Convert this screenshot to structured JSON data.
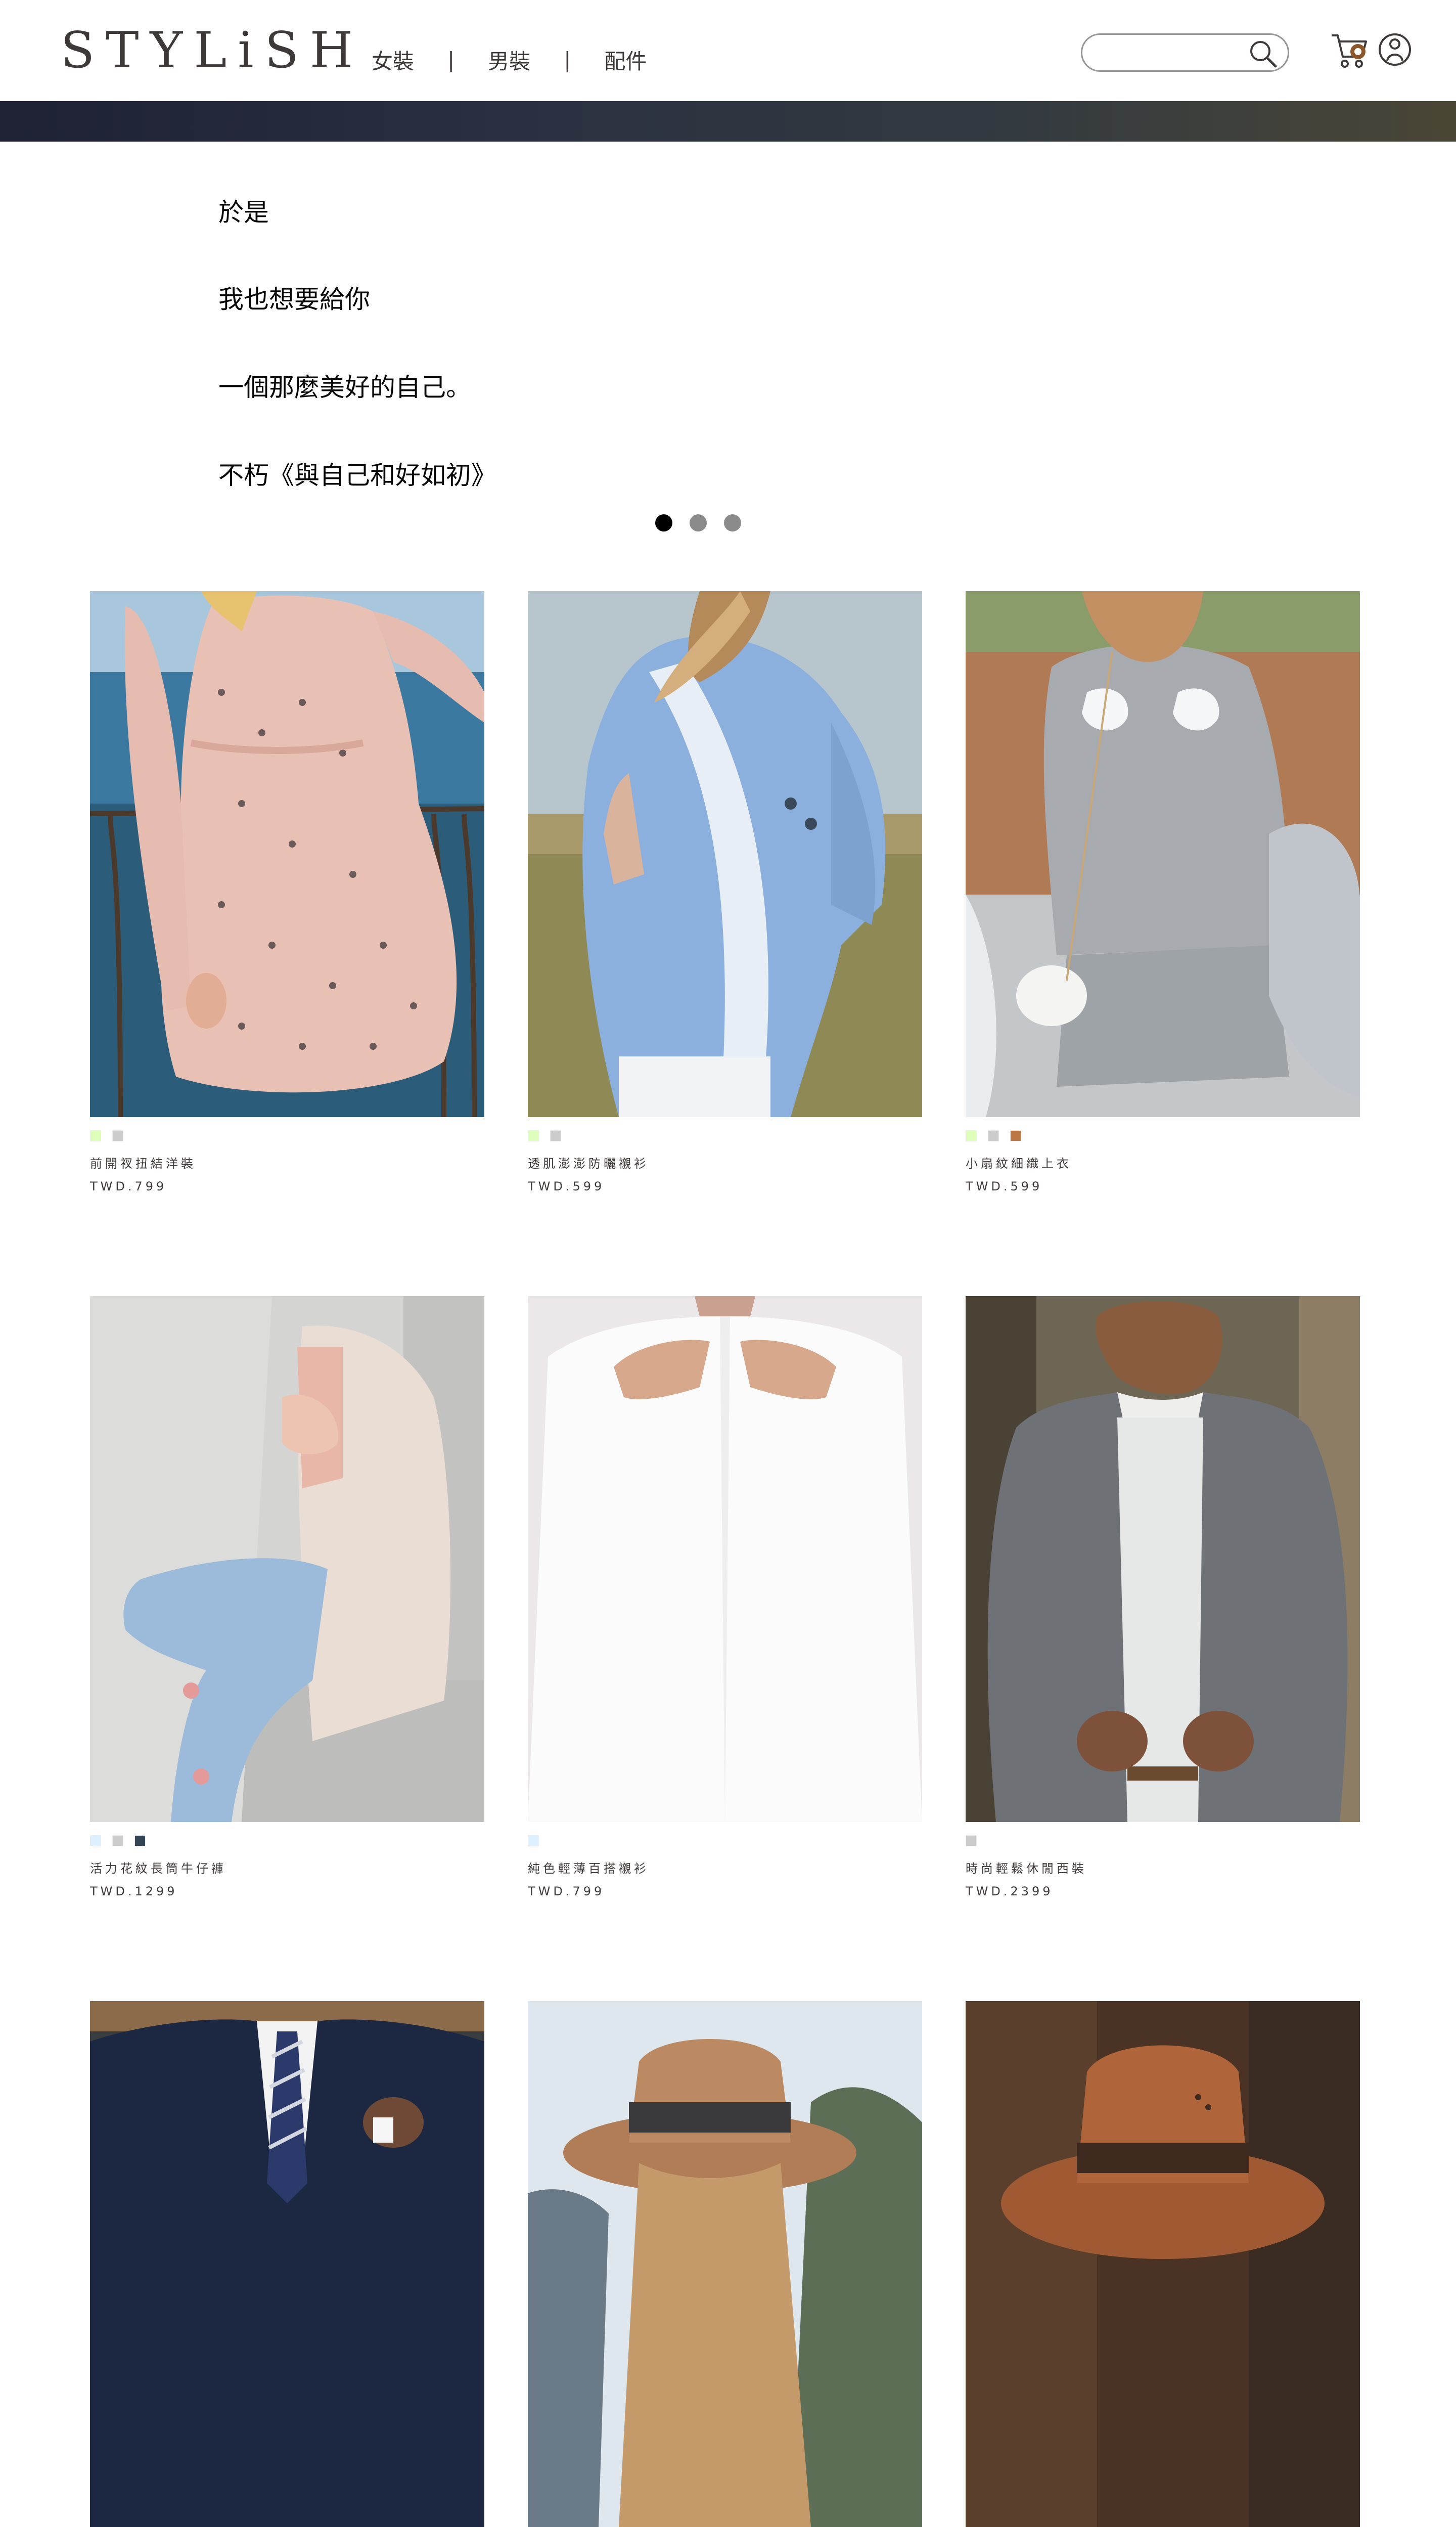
{
  "header": {
    "logo": "STYLiSH",
    "nav": [
      {
        "label": "女裝"
      },
      {
        "label": "男裝"
      },
      {
        "label": "配件"
      }
    ],
    "nav_separator": "|",
    "search": {
      "value": "",
      "placeholder": ""
    }
  },
  "hero": {
    "lines": [
      "於是",
      "我也想要給你",
      "一個那麼美好的自己。",
      "不朽《與自己和好如初》"
    ],
    "dots": [
      {
        "active": true
      },
      {
        "active": false
      },
      {
        "active": false
      }
    ]
  },
  "products": [
    {
      "name": "前開衩扭結洋裝",
      "price": "TWD.799",
      "colors": [
        "#DDFFBB",
        "#CCCCCC"
      ]
    },
    {
      "name": "透肌澎澎防曬襯衫",
      "price": "TWD.599",
      "colors": [
        "#DDFFBB",
        "#CCCCCC"
      ]
    },
    {
      "name": "小扇紋細織上衣",
      "price": "TWD.599",
      "colors": [
        "#DDFFBB",
        "#CCCCCC",
        "#BB7744"
      ]
    },
    {
      "name": "活力花紋長筒牛仔褲",
      "price": "TWD.1299",
      "colors": [
        "#DDF0FF",
        "#CCCCCC",
        "#334455"
      ]
    },
    {
      "name": "純色輕薄百搭襯衫",
      "price": "TWD.799",
      "colors": [
        "#DDF0FF"
      ]
    },
    {
      "name": "時尚輕鬆休閒西裝",
      "price": "TWD.2399",
      "colors": [
        "#CCCCCC"
      ]
    },
    {
      "name": "",
      "price": "",
      "colors": []
    },
    {
      "name": "",
      "price": "",
      "colors": []
    },
    {
      "name": "",
      "price": "",
      "colors": []
    }
  ],
  "icons": {
    "search": "search-icon",
    "cart": "cart-icon",
    "member": "member-icon"
  },
  "colors": {
    "text": "#3f3a3a",
    "active_dot": "#000000",
    "inactive_dot": "#8b8b8b"
  }
}
